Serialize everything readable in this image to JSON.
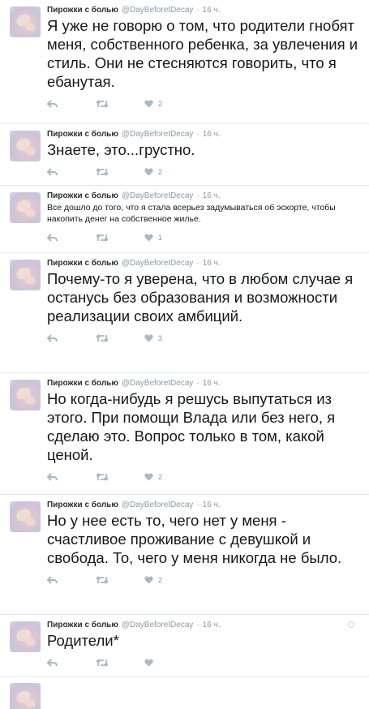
{
  "author": {
    "name": "Пирожки с болью",
    "handle": "@DayBeforeIDecay",
    "dot": "·"
  },
  "tweets": [
    {
      "time": "16 ч.",
      "size": "big",
      "text": "Я уже не говорю о том, что родители гнобят меня, собственного ребенка, за увлечения и стиль. Они не стесняются говорить, что я ебанутая.",
      "likes": "2"
    },
    {
      "time": "16 ч.",
      "size": "big",
      "text": "Знаете, это...грустно.",
      "likes": "2"
    },
    {
      "time": "16 ч.",
      "size": "small",
      "text": "Все дошло до того, что я стала всерьез задумываться об эскорте, чтобы накопить денег на собственное жилье.",
      "likes": "1"
    },
    {
      "time": "16 ч.",
      "size": "big",
      "text": "Почему-то я уверена, что в любом случае я останусь без образования и возможности реализации своих амбиций.",
      "likes": "3"
    },
    {
      "time": "16 ч.",
      "size": "big",
      "text": "Но когда-нибудь я решусь выпутаться из этого. При помощи Влада или без него, я сделаю это. Вопрос только в том, какой ценой.",
      "likes": "2"
    },
    {
      "time": "16 ч.",
      "size": "big",
      "text": "Но у нее есть то, чего нет у меня - счастливое проживание с девушкой и свобода. То, чего у меня никогда не было.",
      "likes": "2"
    },
    {
      "time": "16 ч.",
      "size": "big",
      "text": "Родители*",
      "likes": ""
    },
    {
      "time": "",
      "size": "big",
      "text": "",
      "likes": ""
    }
  ],
  "icons": {
    "reply": "reply-icon",
    "retweet": "retweet-icon",
    "like": "heart-icon",
    "more": "more-options-icon",
    "avatar": "avatar"
  },
  "colors": {
    "action_gray": "#aab8c2",
    "meta_gray": "#8899a6",
    "divider": "#e1e8ed",
    "text": "#14171a"
  }
}
